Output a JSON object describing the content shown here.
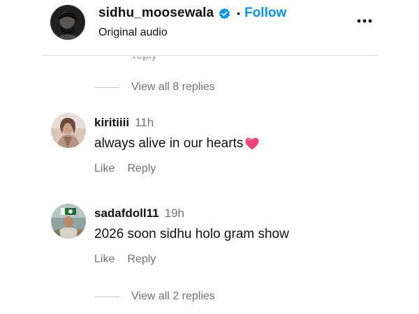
{
  "header": {
    "username": "sidhu_moosewala",
    "separator": "•",
    "follow_label": "Follow",
    "subtitle": "Original audio",
    "verified_icon": "verified-badge-icon",
    "more_icon": "more-horizontal-icon"
  },
  "clipped_text": "reply",
  "threads": [
    {
      "view_replies_label": "View all 8 replies"
    }
  ],
  "comments": [
    {
      "username": "kiritiiii",
      "time": "11h",
      "text": "always alive in our hearts",
      "emoji": "heart-emoji",
      "like_label": "Like",
      "reply_label": "Reply",
      "view_replies_label": ""
    },
    {
      "username": "sadafdoll11",
      "time": "19h",
      "text": "2026 soon sidhu holo gram show",
      "like_label": "Like",
      "reply_label": "Reply",
      "view_replies_label": "View all 2 replies"
    }
  ],
  "colors": {
    "follow": "#0095f6",
    "verified": "#0095f6",
    "secondary_text": "#737373",
    "heart": "#f0447a"
  }
}
